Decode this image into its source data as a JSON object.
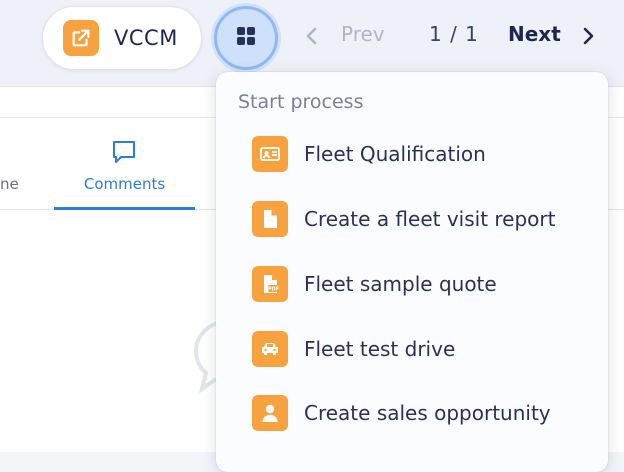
{
  "header": {
    "app_button": {
      "label": "VCCM",
      "icon": "external-link-icon"
    },
    "grid_button": {
      "icon": "grid-icon"
    },
    "pagination": {
      "prev_label": "Prev",
      "page_indicator": "1 / 1",
      "next_label": "Next"
    }
  },
  "tabs": [
    {
      "label": "ne",
      "partial": true
    },
    {
      "label": "Comments",
      "icon": "comment-icon",
      "active": true
    }
  ],
  "dropdown": {
    "heading": "Start process",
    "items": [
      {
        "label": "Fleet Qualification",
        "icon": "id-card-icon"
      },
      {
        "label": "Create a fleet visit report",
        "icon": "document-icon"
      },
      {
        "label": "Fleet sample quote",
        "icon": "pdf-file-icon"
      },
      {
        "label": "Fleet test drive",
        "icon": "car-icon"
      },
      {
        "label": "Create sales opportunity",
        "icon": "person-icon"
      }
    ]
  },
  "colors": {
    "accent": "#2f7bd8",
    "icon_bg": "#f7a23e",
    "text": "#2a3158"
  }
}
